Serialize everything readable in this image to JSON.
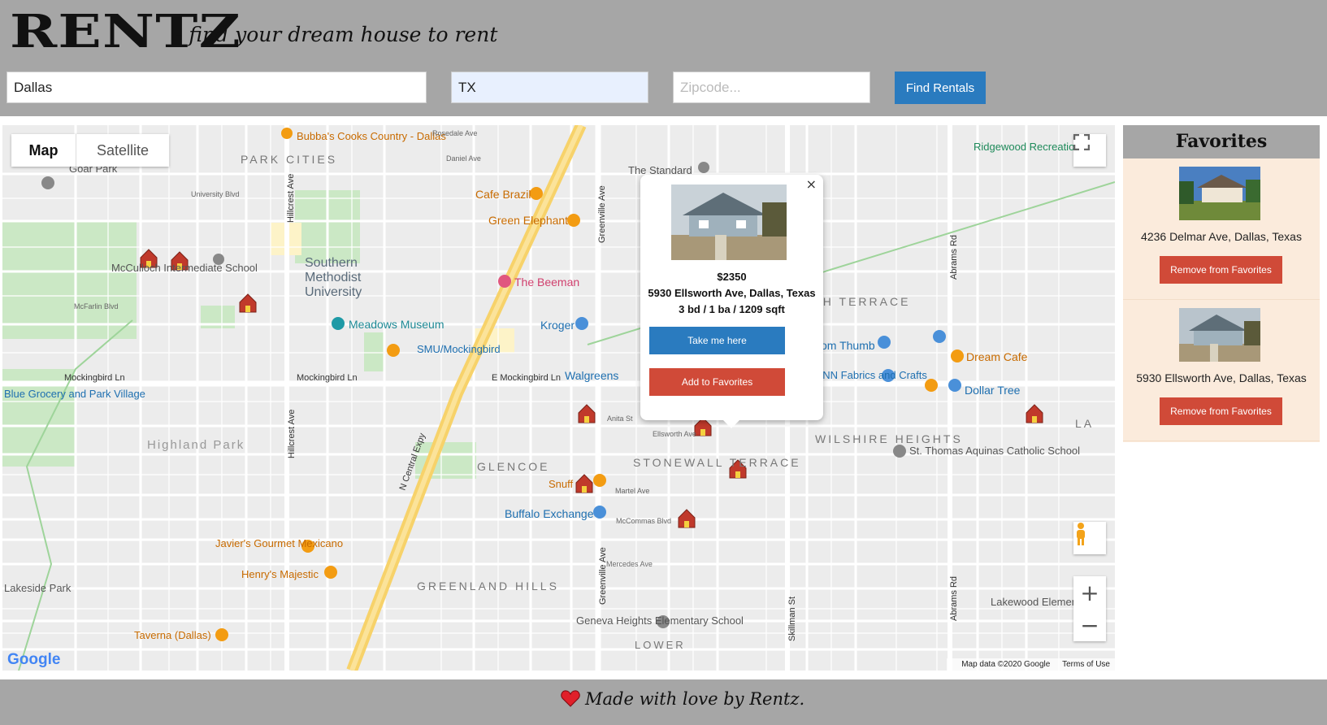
{
  "header": {
    "logo": "RENTZ",
    "tagline": "- find your dream house to rent"
  },
  "search": {
    "city_value": "Dallas",
    "state_value": "TX",
    "zip_placeholder": "Zipcode...",
    "find_label": "Find Rentals"
  },
  "map": {
    "type_map": "Map",
    "type_satellite": "Satellite",
    "google_logo": "Google",
    "map_data": "Map data ©2020 Google",
    "terms": "Terms of Use",
    "labels": {
      "park_cities": "PARK CITIES",
      "smu": "Southern Methodist University",
      "meadows": "Meadows Museum",
      "smu_mock": "SMU/Mockingbird",
      "cafe_brazil": "Cafe Brazil",
      "green_elephant": "Green Elephant",
      "the_beeman": "The Beeman",
      "kroger": "Kroger",
      "walgreens": "Walgreens",
      "the_standard": "The Standard",
      "bubbas": "Bubba's Cooks Country - Dallas",
      "goar_park": "Goar Park",
      "mcculloch": "McCulloch Intermediate School",
      "blue_grocery": "Blue Grocery and Park Village",
      "highland_park": "Highland Park",
      "glencoe": "GLENCOE",
      "stonewall": "STONEWALL TERRACE",
      "greenland": "GREENLAND HILLS",
      "wilshire": "WILSHIRE HEIGHTS",
      "ruth_terrace": "RUTH TERRACE",
      "tom_thumb": "Tom Thumb",
      "joann": "JOANN Fabrics and Crafts",
      "dream_cafe": "Dream Cafe",
      "dollar_tree": "Dollar Tree",
      "st_thomas": "St. Thomas Aquinas Catholic School",
      "buffalo": "Buffalo Exchange",
      "snuff": "Snuff",
      "javiers": "Javier's Gourmet Mexicano",
      "henrys": "Henry's Majestic",
      "taverna": "Taverna (Dallas)",
      "lakeside": "Lakeside Park",
      "geneva": "Geneva Heights Elementary School",
      "ridgewood": "Ridgewood Recreation",
      "lower": "LOWER",
      "lakewood_elem": "Lakewood Elementary",
      "mockingbird_ln": "Mockingbird Ln",
      "e_mockingbird": "E Mockingbird Ln",
      "greenville": "Greenville Ave",
      "n_central": "N Central Expy",
      "hillcrest": "Hillcrest Ave",
      "abrams": "Abrams Rd",
      "skillman": "Skillman St",
      "mcfarlin": "McFarlin Blvd",
      "university": "University Blvd",
      "daniel": "Daniel Ave",
      "rosedale": "Rosedale Ave",
      "mccommas": "McCommas Blvd",
      "mercedes": "Mercedes Ave",
      "ellsworth": "Ellsworth Ave",
      "martel": "Martel Ave",
      "anita": "Anita St",
      "la": "LA"
    }
  },
  "popup": {
    "close": "×",
    "price": "$2350",
    "address": "5930 Ellsworth Ave, Dallas, Texas",
    "specs": "3 bd / 1 ba / 1209 sqft",
    "take_label": "Take me here",
    "add_label": "Add to Favorites"
  },
  "favorites": {
    "title": "Favorites",
    "items": [
      {
        "address": "4236 Delmar Ave, Dallas, Texas",
        "remove_label": "Remove from Favorites"
      },
      {
        "address": "5930 Ellsworth Ave, Dallas, Texas",
        "remove_label": "Remove from Favorites"
      }
    ]
  },
  "footer": {
    "text": "Made with love by Rentz."
  },
  "colors": {
    "blue_button": "#2a7bbf",
    "red_button": "#d04a38",
    "header_gray": "#a6a6a6",
    "fav_bg": "#fbebdc"
  },
  "icons": [
    "house-marker-icon",
    "fullscreen-icon",
    "pegman-icon",
    "zoom-in-icon",
    "zoom-out-icon",
    "heart-icon",
    "close-icon"
  ]
}
